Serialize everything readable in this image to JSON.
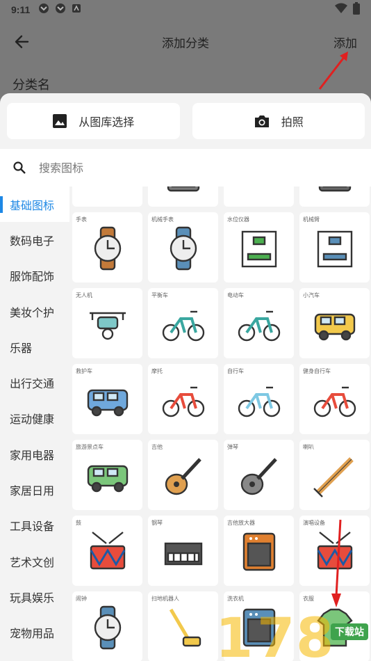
{
  "status": {
    "time": "9:11"
  },
  "topbar": {
    "title": "添加分类",
    "add_label": "添加"
  },
  "form": {
    "name_label": "分类名"
  },
  "sheet": {
    "gallery_label": "从图库选择",
    "camera_label": "拍照",
    "search_placeholder": "搜索图标"
  },
  "categories": [
    "基础图标",
    "数码电子",
    "服饰配饰",
    "美妆个护",
    "乐器",
    "出行交通",
    "运动健康",
    "家用电器",
    "家居日用",
    "工具设备",
    "艺术文创",
    "玩具娱乐",
    "宠物用品"
  ],
  "icons": [
    {
      "label": "",
      "icon": "projector-icon",
      "color": "#4a90c2"
    },
    {
      "label": "",
      "icon": "mixer-icon",
      "color": "#7a7a7a"
    },
    {
      "label": "",
      "icon": "headset-icon",
      "color": "#555"
    },
    {
      "label": "",
      "icon": "server-icon",
      "color": "#666"
    },
    {
      "label": "手表",
      "icon": "watch-icon",
      "color": "#c27a3a"
    },
    {
      "label": "机械手表",
      "icon": "mechanical-watch-icon",
      "color": "#5a8fb8"
    },
    {
      "label": "水位仪器",
      "icon": "3d-printer-icon",
      "color": "#4caf50"
    },
    {
      "label": "机械臂",
      "icon": "robot-arm-icon",
      "color": "#5a8fb8"
    },
    {
      "label": "无人机",
      "icon": "drone-icon",
      "color": "#7ec8c8"
    },
    {
      "label": "平衡车",
      "icon": "balance-scooter-icon",
      "color": "#3aa7a0"
    },
    {
      "label": "电动车",
      "icon": "electric-scooter-icon",
      "color": "#3aa7a0"
    },
    {
      "label": "小汽车",
      "icon": "car-icon",
      "color": "#f2c94c"
    },
    {
      "label": "救护车",
      "icon": "rv-icon",
      "color": "#6fa8dc"
    },
    {
      "label": "摩托",
      "icon": "motorcycle-icon",
      "color": "#e74c3c"
    },
    {
      "label": "自行车",
      "icon": "bicycle-icon",
      "color": "#7ec8e3"
    },
    {
      "label": "健身自行车",
      "icon": "kids-bike-icon",
      "color": "#e74c3c"
    },
    {
      "label": "旅游景点车",
      "icon": "bus-icon",
      "color": "#7bc67b"
    },
    {
      "label": "吉他",
      "icon": "guitar-icon",
      "color": "#e0a050"
    },
    {
      "label": "弹琴",
      "icon": "electric-guitar-icon",
      "color": "#888"
    },
    {
      "label": "喇叭",
      "icon": "flute-icon",
      "color": "#e0a050"
    },
    {
      "label": "鼓",
      "icon": "drum-icon",
      "color": "#e74c3c"
    },
    {
      "label": "钢琴",
      "icon": "piano-icon",
      "color": "#555"
    },
    {
      "label": "吉他放大器",
      "icon": "amplifier-icon",
      "color": "#e08030"
    },
    {
      "label": "演唱设备",
      "icon": "drum-kit-icon",
      "color": "#e74c3c"
    },
    {
      "label": "闹钟",
      "icon": "alarm-icon",
      "color": "#5a8fb8"
    },
    {
      "label": "扫地机器人",
      "icon": "vacuum-icon",
      "color": "#f2c94c"
    },
    {
      "label": "洗衣机",
      "icon": "washer-icon",
      "color": "#5a8fb8"
    },
    {
      "label": "衣服",
      "icon": "clothes-icon",
      "color": "#7bc67b"
    }
  ],
  "watermark": {
    "text": "下载站"
  }
}
